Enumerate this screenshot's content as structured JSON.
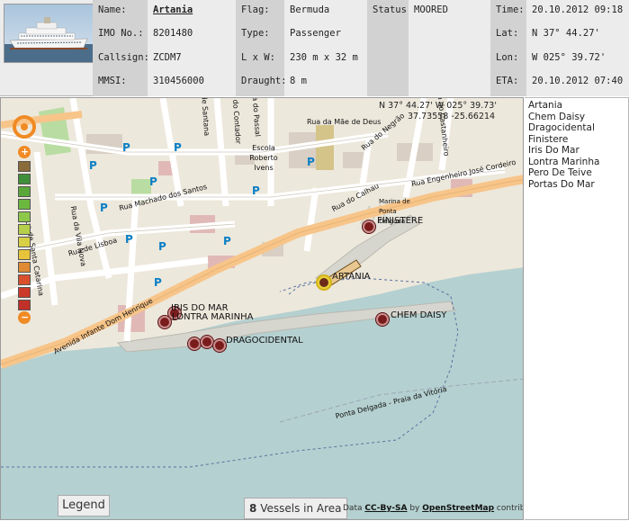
{
  "vessel": {
    "name_label": "Name:",
    "name": "Artania",
    "imo_label": "IMO No.:",
    "imo": "8201480",
    "callsign_label": "Callsign:",
    "callsign": "ZCDM7",
    "mmsi_label": "MMSI:",
    "mmsi": "310456000",
    "flag_label": "Flag:",
    "flag": "Bermuda",
    "type_label": "Type:",
    "type": "Passenger",
    "dims_label": "L x W:",
    "dims": "230 m x 32 m",
    "draught_label": "Draught:",
    "draught": "8 m",
    "status_label": "Status:",
    "status": "MOORED",
    "time_label": "Time:",
    "time": "20.10.2012 09:18",
    "lat_label": "Lat:",
    "lat": "N 37° 44.27'",
    "lon_label": "Lon:",
    "lon": "W 025° 39.72'",
    "eta_label": "ETA:",
    "eta": "20.10.2012 07:40"
  },
  "map": {
    "coord_line1": "N 37° 44.27'  W 025° 39.73'",
    "coord_line2": "37.73558 -25.66214",
    "streets": {
      "s1": "Rua da Mãe de Deus",
      "s2": "Rua Machado dos Santos",
      "s3": "Rua do Calhau",
      "s4": "Rua Engenheiro José Cordeiro",
      "s5": "Rua de Lisboa",
      "s6": "Avenida Infante Dom Henrique",
      "s7": "Rua da Vila Nova",
      "s8": "Rua do Negrão",
      "s9": "Ponta Delgada - Praia da Vitória",
      "school": "Escola Roberto Ivens",
      "marina": "Marina de Ponta Delgada",
      "s10": "Rua de Santana",
      "s11": "Rua do Contador",
      "s12": "Rua do Passal",
      "s13": "Rua do Castanheiro",
      "s14": "Rua de Santa Catarina"
    },
    "vessel_labels": {
      "finistere": "FINISTERE",
      "artania": "ARTANIA",
      "iris": "IRIS DO MAR",
      "lontra": "LONTRA MARINHA",
      "chem": "CHEM DAISY",
      "drago": "DRAGOCIDENTAL"
    },
    "legend_label": "Legend",
    "vessel_count": "8",
    "vessel_count_label": "Vessels in Area",
    "attrib_prefix": "Data",
    "attrib_license": "CC-By-SA",
    "attrib_by": "by",
    "attrib_osm": "OpenStreetMap",
    "attrib_suffix": "contributors",
    "parking_symbol": "P",
    "zoom_plus": "+",
    "zoom_minus": "−"
  },
  "vessel_list": [
    "Artania",
    "Chem Daisy",
    "Dragocidental",
    "Finistere",
    "Iris Do Mar",
    "Lontra Marinha",
    "Pero De Teive",
    "Portas Do Mar"
  ],
  "colors": {
    "sea": "#b5d0d0",
    "land": "#ede8dc",
    "road_major": "#f7c58a",
    "selected": "#e8d23a",
    "vessel": "#7a1c1c"
  }
}
